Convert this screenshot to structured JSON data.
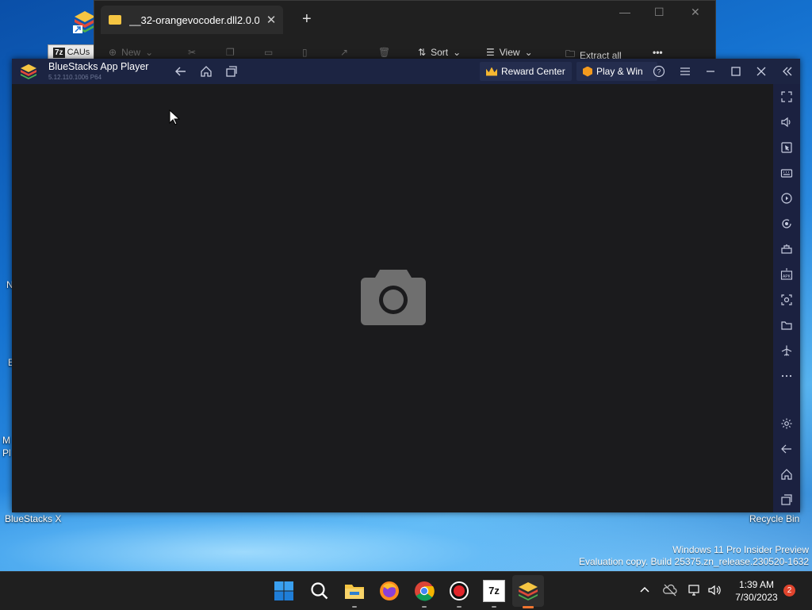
{
  "desktop": {
    "icons": [
      {
        "label": "BlueStacks X"
      },
      {
        "label": "Recycle Bin"
      }
    ],
    "sevenzip_shortcut": {
      "box": "7z",
      "label": "CAUs"
    },
    "edge_fragments": [
      "N",
      "E",
      "M",
      "Pl"
    ]
  },
  "explorer": {
    "tab_title": "__32-orangevocoder.dll2.0.0.0",
    "toolbar": {
      "new_label": "New",
      "sort_label": "Sort",
      "view_label": "View",
      "extract_label": "Extract all"
    }
  },
  "bluestacks": {
    "app_name": "BlueStacks App Player",
    "version": "5.12.110.1006 P64",
    "reward_label": "Reward Center",
    "playwin_label": "Play & Win"
  },
  "watermark": {
    "line1": "Windows 11 Pro Insider Preview",
    "line2": "Evaluation copy. Build 25375.zn_release.230520-1632"
  },
  "taskbar": {
    "sevenzip_label": "7z",
    "time": "1:39 AM",
    "date": "7/30/2023",
    "notification_count": "2"
  },
  "colors": {
    "bluestacks_titlebar": "#1c2442",
    "bluestacks_sidebar": "#1b2140",
    "screen_bg": "#1b1b1d",
    "taskbar_bg": "#1f1f1f",
    "badge": "#e0442d"
  }
}
